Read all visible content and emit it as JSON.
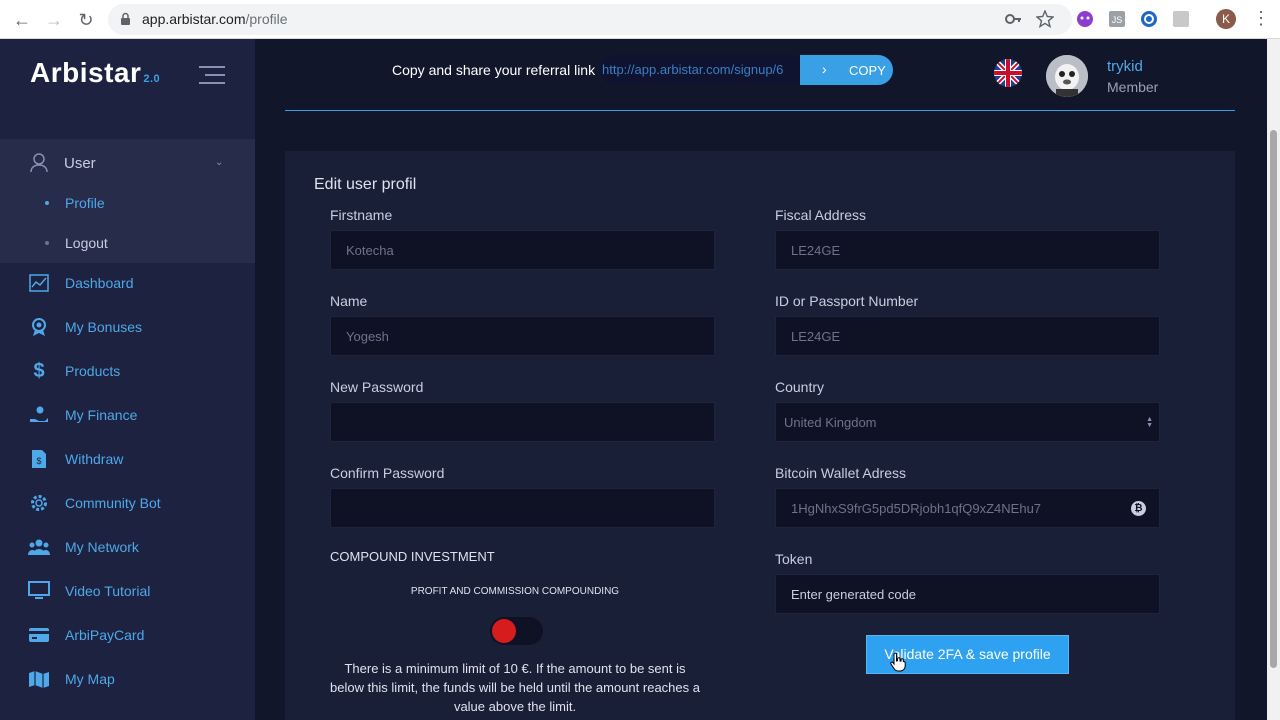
{
  "browser": {
    "url_host": "app.arbistar.com",
    "url_path": "/profile",
    "profile_initial": "K"
  },
  "sidebar": {
    "logo": "Arbistar",
    "logo_version": "2.0",
    "user_group": {
      "label": "User",
      "items": [
        {
          "label": "Profile",
          "active": true
        },
        {
          "label": "Logout",
          "active": false
        }
      ]
    },
    "menu": [
      {
        "label": "Dashboard",
        "icon": "chart-icon"
      },
      {
        "label": "My Bonuses",
        "icon": "award-icon"
      },
      {
        "label": "Products",
        "icon": "dollar-icon"
      },
      {
        "label": "My Finance",
        "icon": "hand-coin-icon"
      },
      {
        "label": "Withdraw",
        "icon": "invoice-icon"
      },
      {
        "label": "Community Bot",
        "icon": "gear-icon"
      },
      {
        "label": "My Network",
        "icon": "users-icon"
      },
      {
        "label": "Video Tutorial",
        "icon": "monitor-icon"
      },
      {
        "label": "ArbiPayCard",
        "icon": "credit-card-icon"
      },
      {
        "label": "My Map",
        "icon": "map-icon"
      }
    ]
  },
  "topbar": {
    "referral_label": "Copy and share your referral link",
    "referral_url": "http://app.arbistar.com/signup/6",
    "copy_label": "COPY",
    "username": "trykid",
    "role": "Member"
  },
  "form": {
    "title": "Edit user profil",
    "firstname_label": "Firstname",
    "firstname_value": "Kotecha",
    "name_label": "Name",
    "name_value": "Yogesh",
    "new_password_label": "New Password",
    "confirm_password_label": "Confirm Password",
    "fiscal_label": "Fiscal Address",
    "fiscal_value": "LE24GE",
    "id_label": "ID or Passport Number",
    "id_value": "LE24GE",
    "country_label": "Country",
    "country_value": "United Kingdom",
    "wallet_label": "Bitcoin Wallet Adress",
    "wallet_value": "1HgNhxS9frG5pd5DRjobh1qfQ9xZ4NEhu7",
    "token_label": "Token",
    "token_placeholder": "Enter generated code",
    "compound_title": "COMPOUND INVESTMENT",
    "compound_sub": "PROFIT AND COMMISSION COMPOUNDING",
    "compound_enabled": false,
    "note": "There is a minimum limit of 10 €. If the amount to be sent is below this limit, the funds will be held until the amount reaches a value above the limit.",
    "save_label": "Validate 2FA & save profile"
  }
}
